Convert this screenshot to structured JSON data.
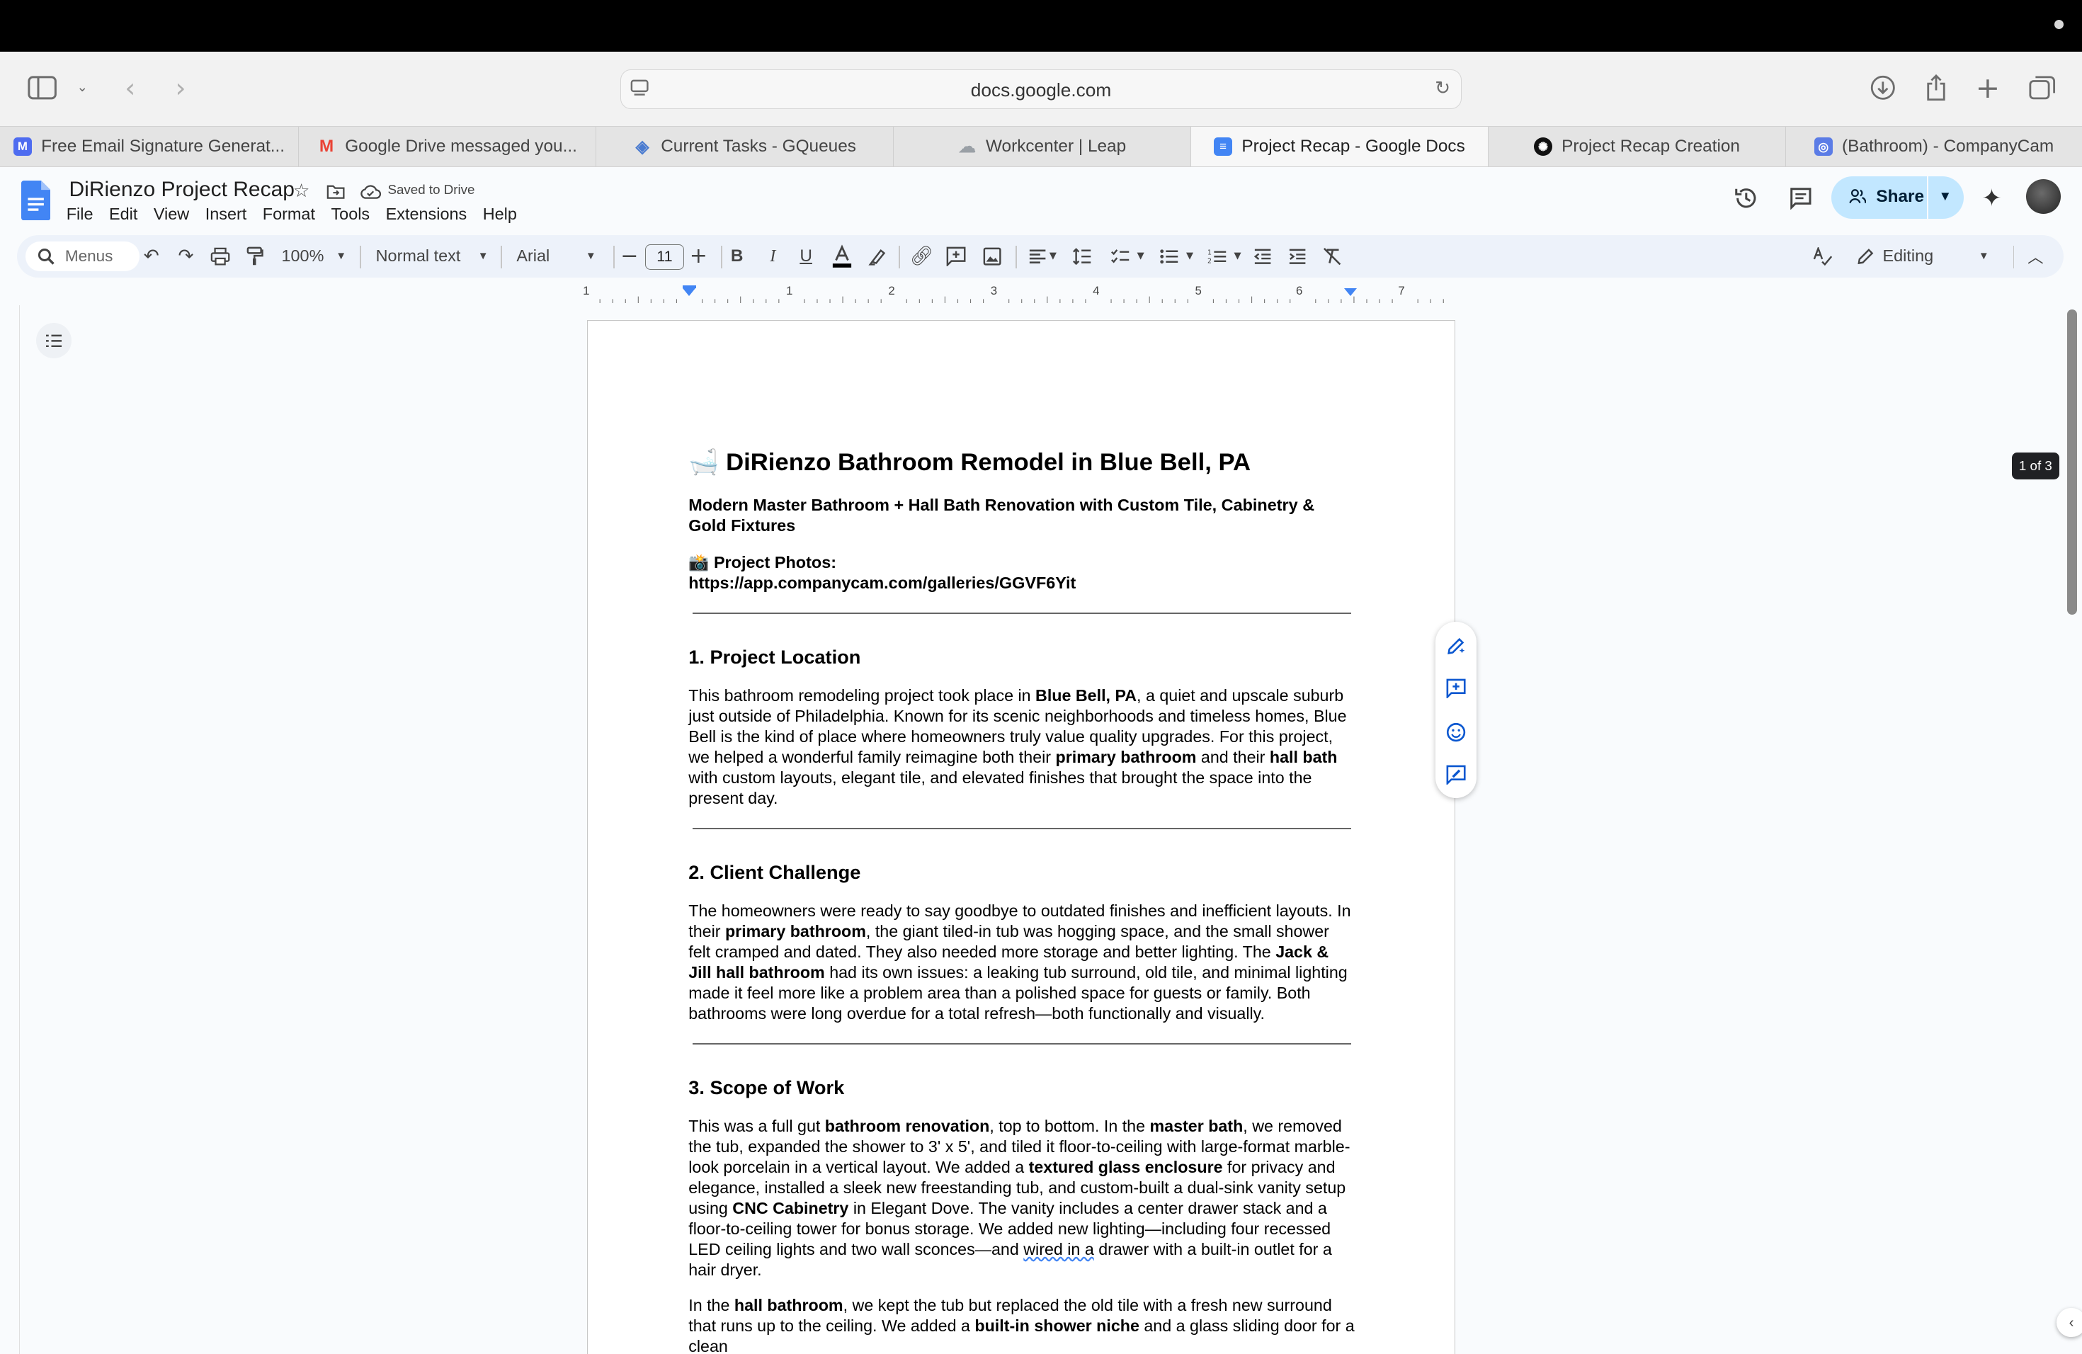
{
  "browser": {
    "url": "docs.google.com",
    "tabs": [
      {
        "label": "Free Email Signature Generat...",
        "icon": "signature-app-icon",
        "color": "#4e6cf0"
      },
      {
        "label": "Google Drive messaged you...",
        "icon": "gmail-icon",
        "color": "#ea4335"
      },
      {
        "label": "Current Tasks - GQueues",
        "icon": "gqueues-icon",
        "color": "#4a7bd0"
      },
      {
        "label": "Workcenter | Leap",
        "icon": "leap-icon",
        "color": "#9aa0a6"
      },
      {
        "label": "Project Recap - Google Docs",
        "icon": "docs-icon",
        "color": "#4285f4"
      },
      {
        "label": "Project Recap Creation",
        "icon": "openai-icon",
        "color": "#111111"
      },
      {
        "label": "(Bathroom) - CompanyCam",
        "icon": "companycam-icon",
        "color": "#5b7ce6"
      }
    ]
  },
  "docs": {
    "title": "DiRienzo Project Recap",
    "saved_status": "Saved to Drive",
    "menu": [
      "File",
      "Edit",
      "View",
      "Insert",
      "Format",
      "Tools",
      "Extensions",
      "Help"
    ],
    "share_label": "Share",
    "toolbar": {
      "search_placeholder": "Menus",
      "zoom": "100%",
      "style": "Normal text",
      "font": "Arial",
      "font_size": "11",
      "mode": "Editing"
    },
    "ruler_numbers": [
      "1",
      "1",
      "2",
      "3",
      "4",
      "5",
      "6",
      "7"
    ],
    "page_count": "1 of 3"
  },
  "document": {
    "title_emoji": "🛁",
    "title": "DiRienzo Bathroom Remodel in Blue Bell, PA",
    "subtitle": "Modern Master Bathroom + Hall Bath Renovation with Custom Tile, Cabinetry & Gold Fixtures",
    "photos_emoji": "📸",
    "photos_label": "Project Photos:",
    "photos_url": "https://app.companycam.com/galleries/GGVF6Yit",
    "s1_heading": "1. Project Location",
    "s1": {
      "a": "This bathroom remodeling project took place in ",
      "b1": "Blue Bell, PA",
      "c": ", a quiet and upscale suburb just outside of Philadelphia. Known for its scenic neighborhoods and timeless homes, Blue Bell is the kind of place where homeowners truly value quality upgrades. For this project, we helped a wonderful family reimagine both their ",
      "b2": "primary bathroom",
      "d": " and their ",
      "b3": "hall bath",
      "e": " with custom layouts, elegant tile, and elevated finishes that brought the space into the present day."
    },
    "s2_heading": "2. Client Challenge",
    "s2": {
      "a": "The homeowners were ready to say goodbye to outdated finishes and inefficient layouts. In their ",
      "b1": "primary bathroom",
      "c": ", the giant tiled-in tub was hogging space, and the small shower felt cramped and dated. They also needed more storage and better lighting. The ",
      "b2": "Jack & Jill hall bathroom",
      "d": " had its own issues: a leaking tub surround, old tile, and minimal lighting made it feel more like a problem area than a polished space for guests or family. Both bathrooms were long overdue for a total refresh—both functionally and visually."
    },
    "s3_heading": "3. Scope of Work",
    "s3p1": {
      "a": "This was a full gut ",
      "b1": "bathroom renovation",
      "c": ", top to bottom. In the ",
      "b2": "master bath",
      "d": ", we removed the tub, expanded the shower to 3' x 5', and tiled it floor-to-ceiling with large-format marble-look porcelain in a vertical layout. We added a ",
      "b3": "textured glass enclosure",
      "e": " for privacy and elegance, installed a sleek new freestanding tub, and custom-built a dual-sink vanity setup using ",
      "b4": "CNC Cabinetry",
      "f": " in Elegant Dove. The vanity includes a center drawer stack and a floor-to-ceiling tower for bonus storage. We added new lighting—including four recessed LED ceiling lights and two wall sconces—and ",
      "u1": "wired in a",
      "g": " drawer with a built-in outlet for a hair dryer."
    },
    "s3p2": {
      "a": "In the ",
      "b1": "hall bathroom",
      "c": ", we kept the tub but replaced the old tile with a fresh new surround that runs up to the ceiling. We added a ",
      "b2": "built-in shower niche",
      "d": " and a glass sliding door for a clean"
    }
  }
}
